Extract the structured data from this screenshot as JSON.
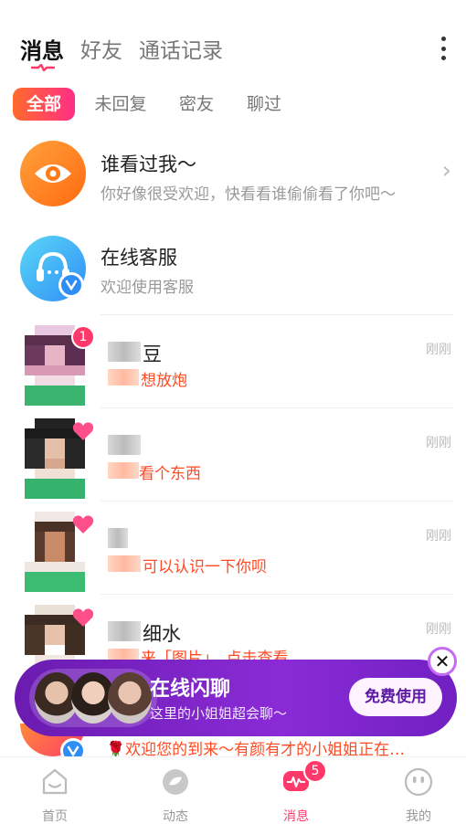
{
  "header": {
    "tabs": [
      {
        "label": "消息",
        "active": true
      },
      {
        "label": "好友",
        "active": false
      },
      {
        "label": "通话记录",
        "active": false
      }
    ]
  },
  "filters": [
    {
      "label": "全部",
      "active": true
    },
    {
      "label": "未回复",
      "active": false
    },
    {
      "label": "密友",
      "active": false
    },
    {
      "label": "聊过",
      "active": false
    }
  ],
  "visitors": {
    "title": "谁看过我～",
    "subtitle": "你好像很受欢迎，快看看谁偷偷看了你吧～"
  },
  "service": {
    "title": "在线客服",
    "subtitle": "欢迎使用客服"
  },
  "conversations": [
    {
      "name": "豆",
      "message": "想放炮",
      "time": "刚刚",
      "unread": "1"
    },
    {
      "name": "",
      "message": "看个东西",
      "time": "刚刚"
    },
    {
      "name": "",
      "message": "可以认识一下你呗",
      "time": "刚刚"
    },
    {
      "name": "细水",
      "message": "来「图片」，点击查看",
      "time": "刚刚"
    },
    {
      "name": "",
      "message": "🌹欢迎您的到来～有颜有才的小姐姐正在…",
      "time": ""
    }
  ],
  "banner": {
    "title": "在线闪聊",
    "subtitle": "这里的小姐姐超会聊～",
    "button": "免费使用"
  },
  "bottom_nav": [
    {
      "label": "首页",
      "icon": "home-icon"
    },
    {
      "label": "动态",
      "icon": "feed-icon"
    },
    {
      "label": "消息",
      "icon": "message-icon",
      "badge": "5",
      "active": true
    },
    {
      "label": "我的",
      "icon": "profile-icon"
    }
  ],
  "colors": {
    "accent": "#ff3a6b",
    "message_red": "#ff4a22",
    "banner_purple": "#7a22c6"
  }
}
